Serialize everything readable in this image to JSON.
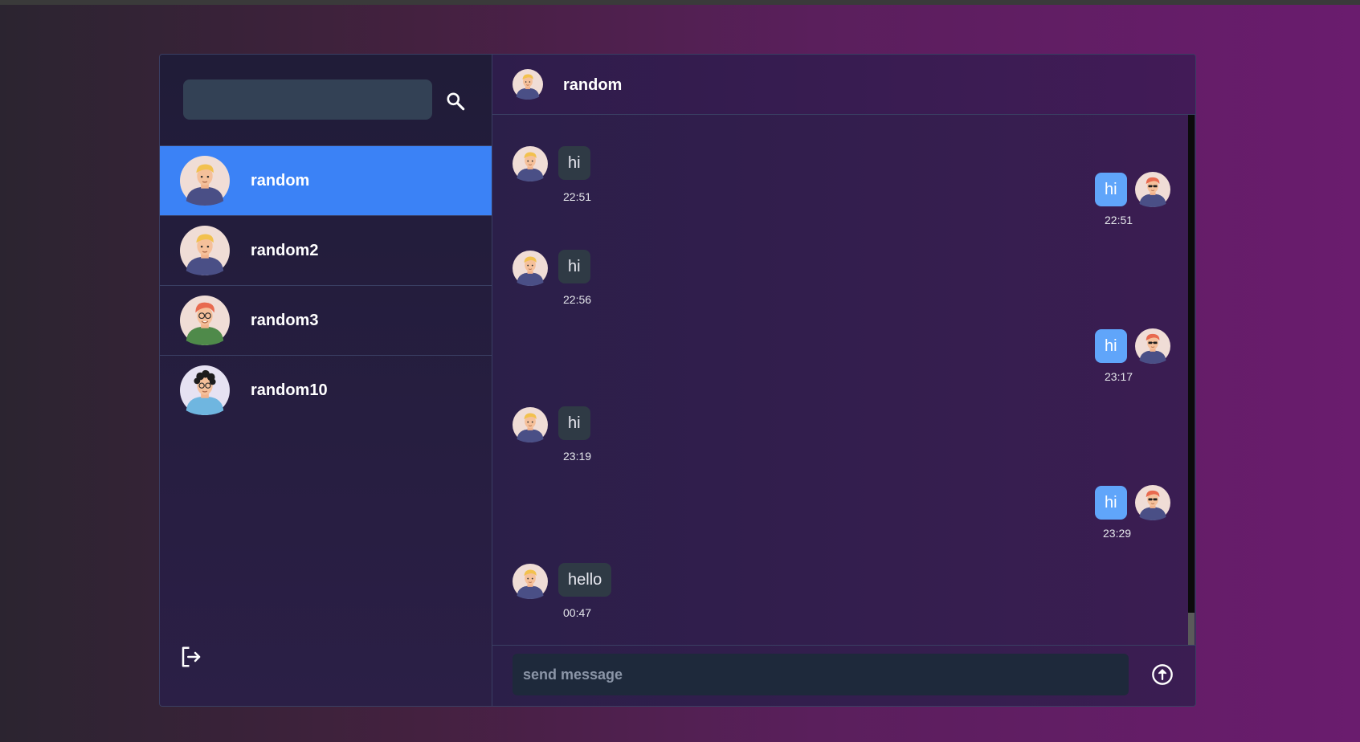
{
  "search": {
    "placeholder": ""
  },
  "contacts": [
    {
      "name": "random",
      "avatar": "blonde-man-avatar",
      "active": true
    },
    {
      "name": "random2",
      "avatar": "blonde-man-avatar",
      "active": false
    },
    {
      "name": "random3",
      "avatar": "redhead-man-glasses-avatar",
      "active": false
    },
    {
      "name": "random10",
      "avatar": "curly-hair-woman-avatar",
      "active": false
    }
  ],
  "chat": {
    "header_name": "random",
    "messages": [
      {
        "direction": "in",
        "text": "hi",
        "time": "22:51"
      },
      {
        "direction": "out",
        "text": "hi",
        "time": "22:51"
      },
      {
        "direction": "in",
        "text": "hi",
        "time": "22:56"
      },
      {
        "direction": "out",
        "text": "hi",
        "time": "23:17"
      },
      {
        "direction": "in",
        "text": "hi",
        "time": "23:19"
      },
      {
        "direction": "out",
        "text": "hi",
        "time": "23:29"
      },
      {
        "direction": "in",
        "text": "hello",
        "time": "00:47"
      }
    ]
  },
  "composer": {
    "placeholder": "send message"
  },
  "icons": {
    "search": "search-icon",
    "logout": "logout-icon",
    "send": "send-arrow-up-circle-icon"
  },
  "colors": {
    "active_contact": "#3b82f6",
    "outgoing_bubble": "#60a5fa",
    "incoming_bubble": "#2f3a45"
  }
}
